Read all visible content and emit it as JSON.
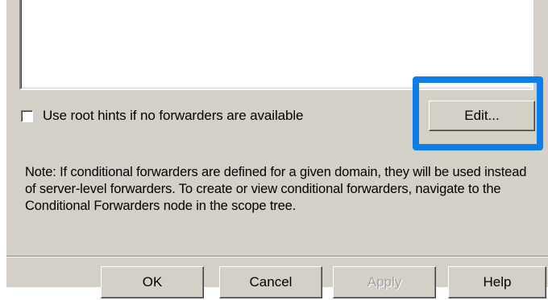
{
  "root_hints": {
    "label": "Use root hints if no forwarders are available",
    "checked": false
  },
  "edit_button": {
    "label": "Edit..."
  },
  "note": {
    "text": "Note: If conditional forwarders are defined for a given domain, they will be used instead of server-level forwarders.  To create or view conditional forwarders, navigate to the Conditional Forwarders node in the scope tree."
  },
  "footer": {
    "ok_label": "OK",
    "cancel_label": "Cancel",
    "apply_label": "Apply",
    "help_label": "Help",
    "apply_enabled": false
  },
  "colors": {
    "dialog_background": "#d4d0c8",
    "highlight_border": "#0d7ee8",
    "disabled_text": "#a0a0a0"
  }
}
